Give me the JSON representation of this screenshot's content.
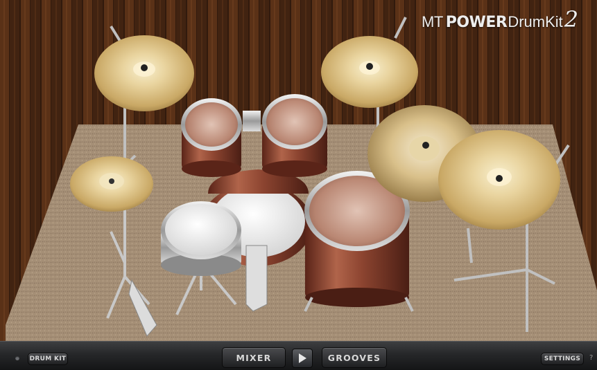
{
  "brand": {
    "prefix": "MT",
    "power": "POWER",
    "drumkit": "DrumKit",
    "version": "2"
  },
  "bottom_bar": {
    "drum_kit_label": "DRUM KIT",
    "mixer_label": "MIXER",
    "grooves_label": "GROOVES",
    "settings_label": "SETTINGS",
    "help_symbol": "?"
  },
  "icons": {
    "play": "play-icon",
    "help": "help-icon"
  }
}
